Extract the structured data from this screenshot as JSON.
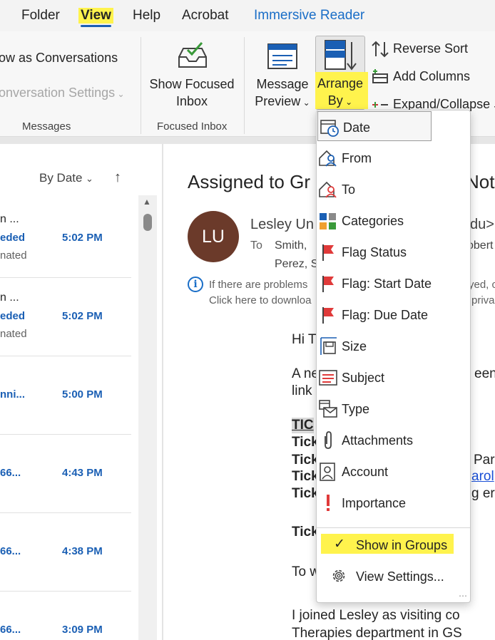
{
  "menubar": {
    "items": [
      {
        "label": "Folder"
      },
      {
        "label": "View"
      },
      {
        "label": "Help"
      },
      {
        "label": "Acrobat"
      },
      {
        "label": "Immersive Reader"
      }
    ]
  },
  "ribbon": {
    "show_as_conversations": "ow as Conversations",
    "conversation_settings": "onversation Settings",
    "messages_group": "Messages",
    "focused_inbox_line1": "Show Focused",
    "focused_inbox_line2": "Inbox",
    "focused_inbox_group": "Focused Inbox",
    "message_preview_line1": "Message",
    "message_preview_line2": "Preview",
    "arrange_by_line1": "Arrange",
    "arrange_by_line2": "By",
    "reverse_sort": "Reverse Sort",
    "add_columns": "Add Columns",
    "expand_collapse": "Expand/Collapse"
  },
  "message_list": {
    "sort_label": "By Date",
    "rows": [
      {
        "line1": "n ...",
        "line2": "eded",
        "line3": "nated",
        "time": "5:02 PM"
      },
      {
        "line1": "n ...",
        "line2": "eded",
        "line3": "nated",
        "time": "5:02 PM"
      },
      {
        "line1": "",
        "line2": "nni...",
        "line3": "",
        "time": "5:00 PM"
      },
      {
        "line1": "",
        "line2": "66...",
        "line3": "",
        "time": "4:43 PM"
      },
      {
        "line1": "",
        "line2": "66...",
        "line3": "",
        "time": "4:38 PM"
      },
      {
        "line1": "",
        "line2": "66...",
        "line3": "",
        "time": "3:09 PM"
      }
    ]
  },
  "reading_pane": {
    "subject": "Assigned to Gr",
    "subject_tail": "Not",
    "avatar_initials": "LU",
    "sender": "Lesley Un",
    "sender_tail": "du>",
    "to_label": "To",
    "to_line1": "Smith,",
    "to_line1_tail": "obert",
    "to_line2": "Perez, S",
    "info_line1": "If there are problems",
    "info_line1_tail": "yed, c",
    "info_line2": "Click here to downloa",
    "info_line2_tail": "priva",
    "greeting": "Hi T",
    "para1_a": "A ne",
    "para1_a_tail": "een",
    "para1_b": "link",
    "tic_label": "TIC",
    "ticket_prefix": "Tick",
    "ticket_tail_1": "Par",
    "ticket_tail_2": "arol",
    "ticket_tail_3": "g er",
    "to_w": "To w",
    "joined_line": "I joined Lesley as visiting co",
    "therapies_line": "Therapies department in GS"
  },
  "arrange_menu": {
    "items": [
      {
        "label": "Date",
        "icon": "calendar-clock-icon"
      },
      {
        "label": "From",
        "icon": "person-from-icon"
      },
      {
        "label": "To",
        "icon": "person-to-icon"
      },
      {
        "label": "Categories",
        "icon": "categories-icon"
      },
      {
        "label": "Flag Status",
        "icon": "flag-icon"
      },
      {
        "label": "Flag: Start Date",
        "icon": "flag-start-icon"
      },
      {
        "label": "Flag: Due Date",
        "icon": "flag-due-icon"
      },
      {
        "label": "Size",
        "icon": "size-icon"
      },
      {
        "label": "Subject",
        "icon": "subject-icon"
      },
      {
        "label": "Type",
        "icon": "type-icon"
      },
      {
        "label": "Attachments",
        "icon": "paperclip-icon"
      },
      {
        "label": "Account",
        "icon": "account-icon"
      },
      {
        "label": "Importance",
        "icon": "exclamation-icon"
      }
    ],
    "show_in_groups": "Show in Groups",
    "view_settings": "View Settings..."
  },
  "colors": {
    "highlight": "#fff34d",
    "accent_blue": "#1a5fb4",
    "flag_red": "#e03a3a",
    "avatar_bg": "#6b3a2a"
  }
}
